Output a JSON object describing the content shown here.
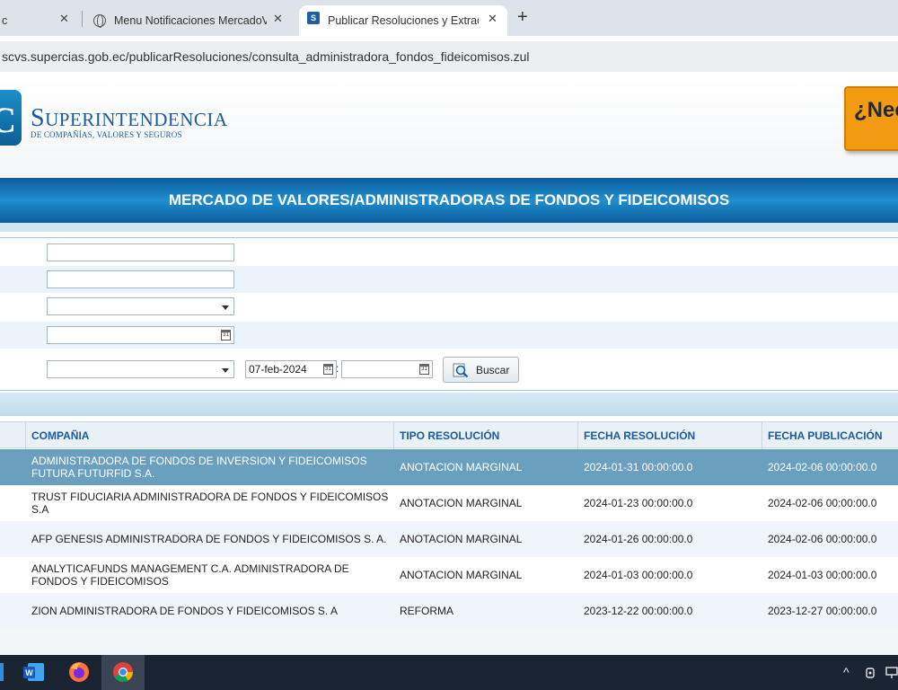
{
  "browser": {
    "tabs": [
      {
        "label": "c",
        "close": "✕"
      },
      {
        "label": "Menu Notificaciones MercadoV",
        "close": "✕"
      },
      {
        "label": "Publicar Resoluciones y Extracto",
        "close": "✕"
      }
    ],
    "new_tab": "+",
    "url": "scvs.supercias.gob.ec/publicarResoluciones/consulta_administradora_fondos_fideicomisos.zul"
  },
  "header": {
    "logo_mark": "C",
    "logo_title_initial": "S",
    "logo_title_rest": "UPERINTENDENCIA",
    "logo_subtitle": "DE COMPAÑÍAS, VALORES Y SEGUROS",
    "help_text": "¿Nec"
  },
  "banner": {
    "title": "MERCADO DE VALORES/ADMINISTRADORAS DE FONDOS Y FIDEICOMISOS"
  },
  "form": {
    "date_from": "07-feb-2024",
    "date_sep": ":",
    "calendar_day": "31",
    "search_button": "Buscar"
  },
  "table": {
    "columns": [
      "COMPAÑIA",
      "TIPO RESOLUCIÓN",
      "FECHA RESOLUCIÓN",
      "FECHA PUBLICACIÓN"
    ],
    "rows": [
      {
        "company": "ADMINISTRADORA DE FONDOS DE INVERSION Y FIDEICOMISOS FUTURA FUTURFID S.A.",
        "type": "ANOTACION MARGINAL",
        "resolution_date": "2024-01-31 00:00:00.0",
        "publication_date": "2024-02-06 00:00:00.0"
      },
      {
        "company": "TRUST FIDUCIARIA ADMINISTRADORA DE FONDOS Y FIDEICOMISOS S.A",
        "type": "ANOTACION MARGINAL",
        "resolution_date": "2024-01-23 00:00:00.0",
        "publication_date": "2024-02-06 00:00:00.0"
      },
      {
        "company": "AFP GENESIS ADMINISTRADORA DE FONDOS Y FIDEICOMISOS S. A.",
        "type": "ANOTACION MARGINAL",
        "resolution_date": "2024-01-26 00:00:00.0",
        "publication_date": "2024-02-06 00:00:00.0"
      },
      {
        "company": "ANALYTICAFUNDS MANAGEMENT C.A. ADMINISTRADORA DE FONDOS Y FIDEICOMISOS",
        "type": "ANOTACION MARGINAL",
        "resolution_date": "2024-01-03 00:00:00.0",
        "publication_date": "2024-01-03 00:00:00.0"
      },
      {
        "company": "ZION ADMINISTRADORA DE FONDOS Y FIDEICOMISOS S. A",
        "type": "REFORMA",
        "resolution_date": "2023-12-22 00:00:00.0",
        "publication_date": "2023-12-27 00:00:00.0"
      }
    ]
  },
  "taskbar": {
    "tray_chevron": "^"
  }
}
